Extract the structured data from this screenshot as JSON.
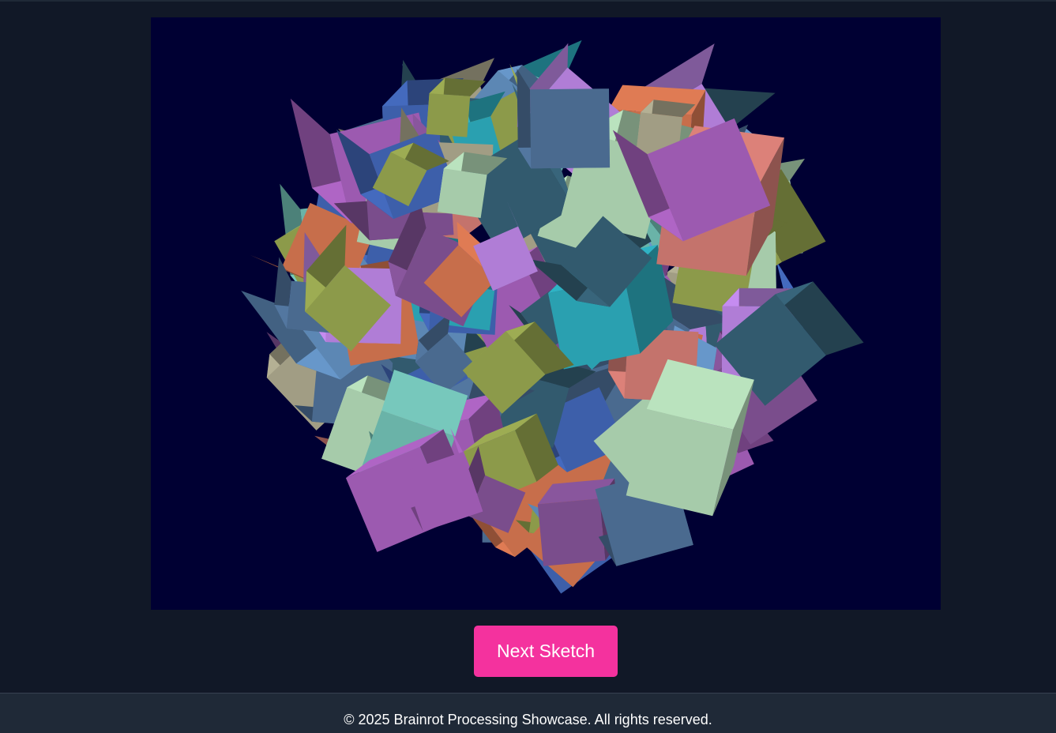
{
  "sketch": {
    "background": "#000033",
    "palette": [
      "#7a4d8c",
      "#4a6a8f",
      "#c4736c",
      "#5c87b4",
      "#b07dd6",
      "#a19d84",
      "#6ab3a8",
      "#3d5faa",
      "#c76e4b",
      "#325a6e",
      "#8c9a4a",
      "#2aa0b0",
      "#a6cbaa",
      "#9c5ab0"
    ]
  },
  "controls": {
    "next_label": "Next Sketch",
    "accent": "#f4329e"
  },
  "footer": {
    "text": "© 2025 Brainrot Processing Showcase. All rights reserved."
  }
}
